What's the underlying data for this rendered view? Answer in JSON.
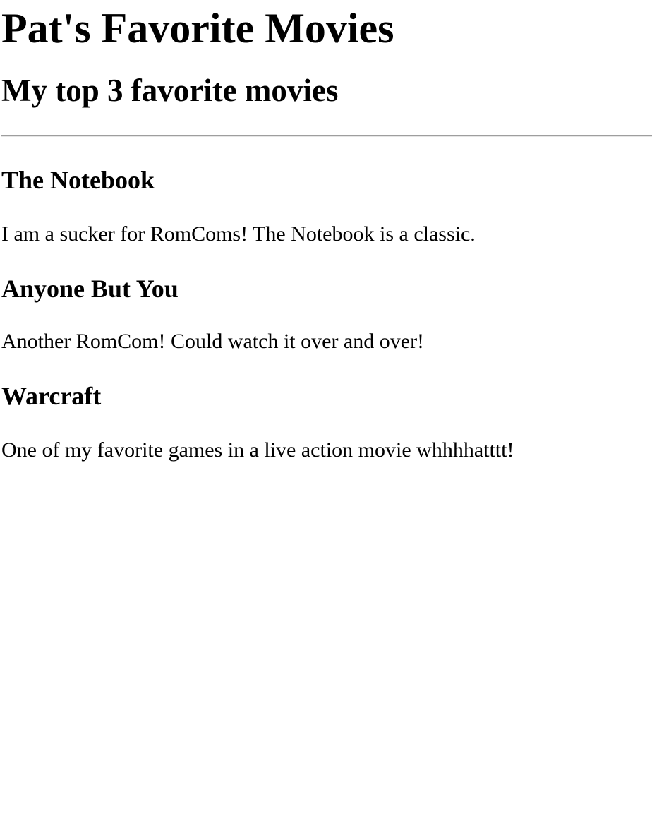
{
  "page": {
    "title": "Pat's Favorite Movies",
    "subtitle": "My top 3 favorite movies"
  },
  "movies": [
    {
      "title": "The Notebook",
      "description": "I am a sucker for RomComs! The Notebook is a classic."
    },
    {
      "title": "Anyone But You",
      "description": "Another RomCom! Could watch it over and over!"
    },
    {
      "title": "Warcraft",
      "description": "One of my favorite games in a live action movie whhhhatttt!"
    }
  ]
}
